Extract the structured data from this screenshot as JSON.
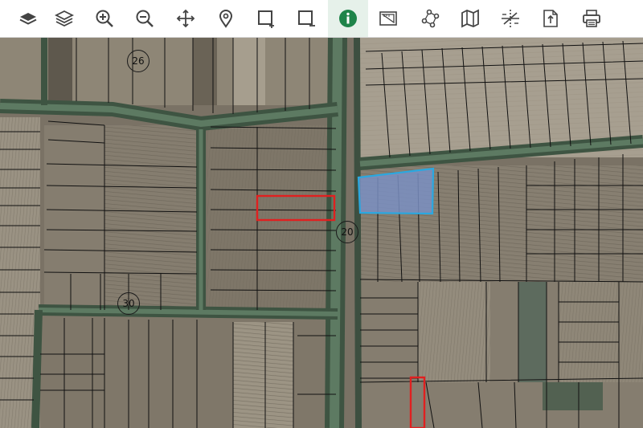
{
  "toolbar": {
    "tools": [
      {
        "icon": "layer-icon"
      },
      {
        "icon": "layers-stack-icon"
      },
      {
        "icon": "zoom-in-icon"
      },
      {
        "icon": "zoom-out-icon"
      },
      {
        "icon": "pan-move-icon"
      },
      {
        "icon": "location-pin-icon"
      },
      {
        "icon": "add-rectangle-icon"
      },
      {
        "icon": "remove-rectangle-icon"
      },
      {
        "icon": "info-icon",
        "active": true
      },
      {
        "icon": "measure-area-icon"
      },
      {
        "icon": "polygon-nodes-icon"
      },
      {
        "icon": "map-icon"
      },
      {
        "icon": "split-parcel-icon"
      },
      {
        "icon": "export-document-icon"
      },
      {
        "icon": "print-icon"
      }
    ],
    "active_color": "#1e8449",
    "icon_color": "#444444"
  },
  "map": {
    "road_labels": [
      "26",
      "20",
      "30"
    ],
    "highlight_color": "#e02020",
    "selection_color": "#2aa8e0",
    "parcel_line_color": "#111111",
    "road_color": "#56735c"
  }
}
